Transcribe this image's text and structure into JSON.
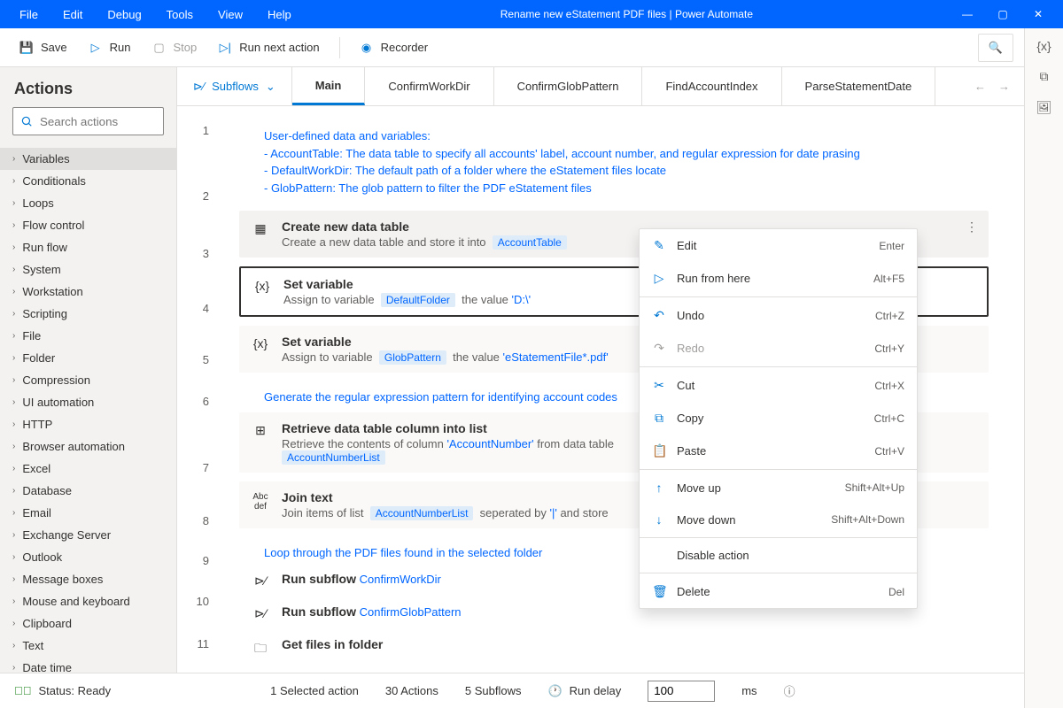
{
  "title": "Rename new eStatement PDF files | Power Automate",
  "menu": [
    "File",
    "Edit",
    "Debug",
    "Tools",
    "View",
    "Help"
  ],
  "toolbar": {
    "save": "Save",
    "run": "Run",
    "stop": "Stop",
    "runNext": "Run next action",
    "recorder": "Recorder"
  },
  "sidebar": {
    "title": "Actions",
    "searchPlaceholder": "Search actions",
    "categories": [
      "Variables",
      "Conditionals",
      "Loops",
      "Flow control",
      "Run flow",
      "System",
      "Workstation",
      "Scripting",
      "File",
      "Folder",
      "Compression",
      "UI automation",
      "HTTP",
      "Browser automation",
      "Excel",
      "Database",
      "Email",
      "Exchange Server",
      "Outlook",
      "Message boxes",
      "Mouse and keyboard",
      "Clipboard",
      "Text",
      "Date time"
    ]
  },
  "tabs": {
    "subflows": "Subflows",
    "items": [
      "Main",
      "ConfirmWorkDir",
      "ConfirmGlobPattern",
      "FindAccountIndex",
      "ParseStatementDate"
    ]
  },
  "comment1": {
    "l0": "User-defined data and variables:",
    "l1": "- AccountTable: The data table to specify all accounts' label, account number, and regular expression for date prasing",
    "l2": "- DefaultWorkDir: The default path of a folder where the eStatement files locate",
    "l3": "- GlobPattern: The glob pattern to filter the PDF eStatement files"
  },
  "step2": {
    "title": "Create new data table",
    "d1": "Create a new data table and store it into",
    "v1": "AccountTable"
  },
  "step3": {
    "title": "Set variable",
    "d1": "Assign to variable",
    "v1": "DefaultFolder",
    "d2": "the value",
    "d3": "'D:\\'"
  },
  "step4": {
    "title": "Set variable",
    "d1": "Assign to variable",
    "v1": "GlobPattern",
    "d2": "the value",
    "d3": "'eStatementFile*.pdf'"
  },
  "region5": "Generate the regular expression pattern for identifying account codes",
  "step6": {
    "title": "Retrieve data table column into list",
    "d1": "Retrieve the contents of column",
    "d2": "'AccountNumber'",
    "d3": "from data table",
    "v1": "AccountNumberList"
  },
  "step7": {
    "title": "Join text",
    "d1": "Join items of list",
    "v1": "AccountNumberList",
    "d2": "seperated by",
    "d3": "'|'",
    "d4": "and store"
  },
  "region8": "Loop through the PDF files found in the selected folder",
  "step9": {
    "title": "Run subflow",
    "v1": "ConfirmWorkDir"
  },
  "step10": {
    "title": "Run subflow",
    "v1": "ConfirmGlobPattern"
  },
  "step11": {
    "title": "Get files in folder"
  },
  "lineNumbers": [
    "1",
    "2",
    "3",
    "4",
    "5",
    "6",
    "7",
    "8",
    "9",
    "10",
    "11"
  ],
  "context": {
    "items": [
      {
        "icon": "✎",
        "label": "Edit",
        "short": "Enter"
      },
      {
        "icon": "▷",
        "label": "Run from here",
        "short": "Alt+F5"
      },
      {
        "sep": true
      },
      {
        "icon": "↶",
        "label": "Undo",
        "short": "Ctrl+Z"
      },
      {
        "icon": "↷",
        "label": "Redo",
        "short": "Ctrl+Y",
        "disabled": true
      },
      {
        "sep": true
      },
      {
        "icon": "✂",
        "label": "Cut",
        "short": "Ctrl+X"
      },
      {
        "icon": "⧉",
        "label": "Copy",
        "short": "Ctrl+C"
      },
      {
        "icon": "📋",
        "label": "Paste",
        "short": "Ctrl+V"
      },
      {
        "sep": true
      },
      {
        "icon": "↑",
        "label": "Move up",
        "short": "Shift+Alt+Up"
      },
      {
        "icon": "↓",
        "label": "Move down",
        "short": "Shift+Alt+Down"
      },
      {
        "sep": true
      },
      {
        "icon": "",
        "label": "Disable action",
        "short": ""
      },
      {
        "sep": true
      },
      {
        "icon": "🗑",
        "label": "Delete",
        "short": "Del"
      }
    ]
  },
  "status": {
    "ready": "Status: Ready",
    "selected": "1 Selected action",
    "actions": "30 Actions",
    "subflows": "5 Subflows",
    "runDelay": "Run delay",
    "delayVal": "100",
    "ms": "ms"
  }
}
